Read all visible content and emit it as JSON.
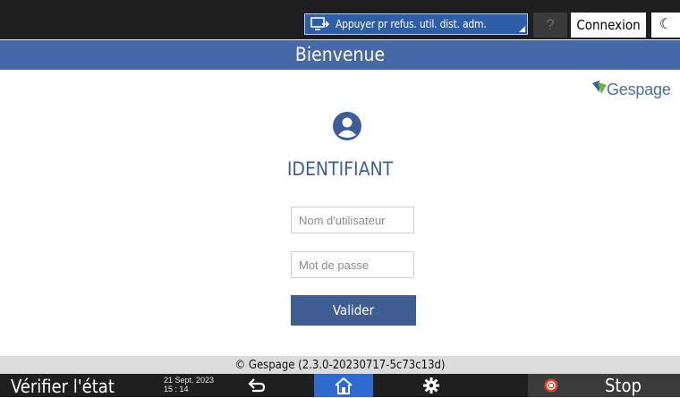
{
  "topbar": {
    "remote_label": "Appuyer pr refus. util. dist. adm.",
    "help_label": "?",
    "login_label": "Connexion",
    "night_label": "☾"
  },
  "header": {
    "title": "Bienvenue"
  },
  "logo": {
    "text": "Gespage"
  },
  "form": {
    "title": "IDENTIFIANT",
    "username_placeholder": "Nom d'utilisateur",
    "password_placeholder": "Mot de passe",
    "submit_label": "Valider"
  },
  "footer": {
    "copyright": "© Gespage (2.3.0-20230717-5c73c13d)"
  },
  "bottombar": {
    "status_label": "Vérifier l'état",
    "date": "21 Sept. 2023",
    "time": "15 : 14",
    "stop_label": "Stop"
  },
  "icons": {
    "remote": "remote-screen-icon",
    "user": "user-circle-icon",
    "back": "back-arrow-icon",
    "home": "home-icon",
    "settings": "gear-icon",
    "stop": "stop-icon",
    "night": "moon-icon"
  },
  "colors": {
    "header": "#4668a6",
    "accent_blue": "#2f6ad2",
    "button": "#3f5d93",
    "stop": "#e0402a"
  }
}
